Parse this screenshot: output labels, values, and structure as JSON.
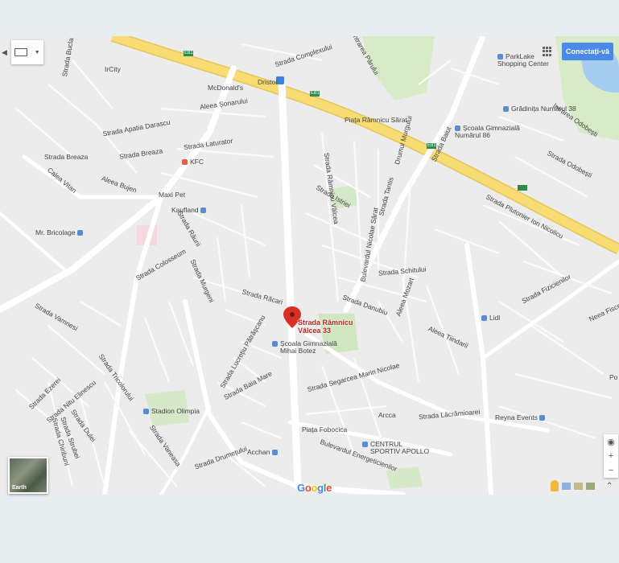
{
  "header": {
    "connect_label": "Conectați-vă"
  },
  "labels": {
    "strada_bucla": "Strada Bucla",
    "ircity": "IrCity",
    "mcdonalds": "McDonald's",
    "dristor": "Dristor",
    "strada_complexului": "Strada Complexului",
    "intrarea_parului": "Intrarea Pârului",
    "parklake": "ParkLake Shopping Center",
    "gradinita": "Grădinița Numărul 38",
    "scoala86": "Școala Gimnazială Numărul 86",
    "aleea_sonarului": "Aleea Șonarului",
    "strada_apatia": "Strada Apatia Darascu",
    "piata_ramnicu": "Piața Râmnicu Sărat",
    "strada_odobesti": "Strada Odobești",
    "intrarea_odobesti": "Intrarea Odobești",
    "drumul_murgului": "Drumul Murgului",
    "strada_baiut": "Strada Baiut",
    "strada_laturator": "Strada Laturator",
    "strada_breaza": "Strada Breaza",
    "strada_breaza2": "Strada Breaza",
    "kfc": "KFC",
    "maxi_pet": "Maxi Pet",
    "kaufland": "Kaufland",
    "mr_bricolage": "Mr. Bricolage",
    "aleea_bujen": "Aleea Bujen",
    "calea_vitan": "Calea Vitan",
    "strada_raurii": "Strada Răurii",
    "strada_colosseum": "Strada Colosseum",
    "strada_ramnicu_valcea": "Strada Râmnicu Vâlcea",
    "strada_istriei": "Strada Istriei",
    "strada_tantis": "Strada Tantis",
    "strada_plutonier": "Strada Plutonier Ion Nicolicu",
    "strada_fizicienilor": "Strada Fizicienilor",
    "strada_schitului": "Strada Schitului",
    "bulevardul_nicolae": "Bulevardul Nicolae Sărat",
    "strada_danubiu": "Strada Danubiu",
    "aleea_mozart": "Aleea Mozart",
    "strada_racari": "Strada Răcari",
    "strada_murgeni": "Strada Murgeni",
    "marker_line1": "Strada Râmnicu",
    "marker_line2": "Vâlcea 33",
    "scoala_gimnaziala": "Școala Gimnazială",
    "scoala_gimnaziala2": "Mihai Botez",
    "lidl": "Lidl",
    "neea_fiscea": "Neea Fiscea",
    "aleea_tiindarii": "Aleea Tiindarii",
    "strada_baba_mare": "Strada Baia Mare",
    "stadion_olimpia": "Stadion Olimpia",
    "strada_lucretiu": "Strada Lucrețiu Pătrășcanu",
    "strada_segarcea": "Strada Segarcea Marin Nicolae",
    "arcca": "Arcca",
    "strada_lacramioarei": "Strada Lăcrămioarei",
    "reyna_events": "Reyna Events",
    "piata_fobocica": "Piața Fobocica",
    "centrul_sportiv_1": "CENTRUL",
    "centrul_sportiv_2": "SPORTIV APOLLO",
    "acchan": "Acchan",
    "bulevardul_energeticienilor": "Bulevardul Energeticienilor",
    "strada_drumetului": "Strada Drumețului",
    "strada_vaneasa": "Strada Vaneasa",
    "strada_ezerei": "Strada Ezerei",
    "strada_nitu_elinescu": "Strada Nitu Elinescu",
    "strada_vamnesi": "Strada Vamnesi",
    "strada_tricolorului": "Strada Tricolorului",
    "strada_dulei": "Strada Dulei",
    "strada_strubei": "Strada Strubei",
    "strada_chiribuni": "Strada Chiribuni",
    "earth": "Earth",
    "po": "Po",
    "e81_1": "E81",
    "e81_2": "E81",
    "e81_3": "E81"
  },
  "google_logo": "Google",
  "colors": {
    "connect": "#4a89e8",
    "marker": "#d93025",
    "park": "#c8e6b4",
    "water": "#a6cdf0",
    "highway": "#f7dc74"
  }
}
